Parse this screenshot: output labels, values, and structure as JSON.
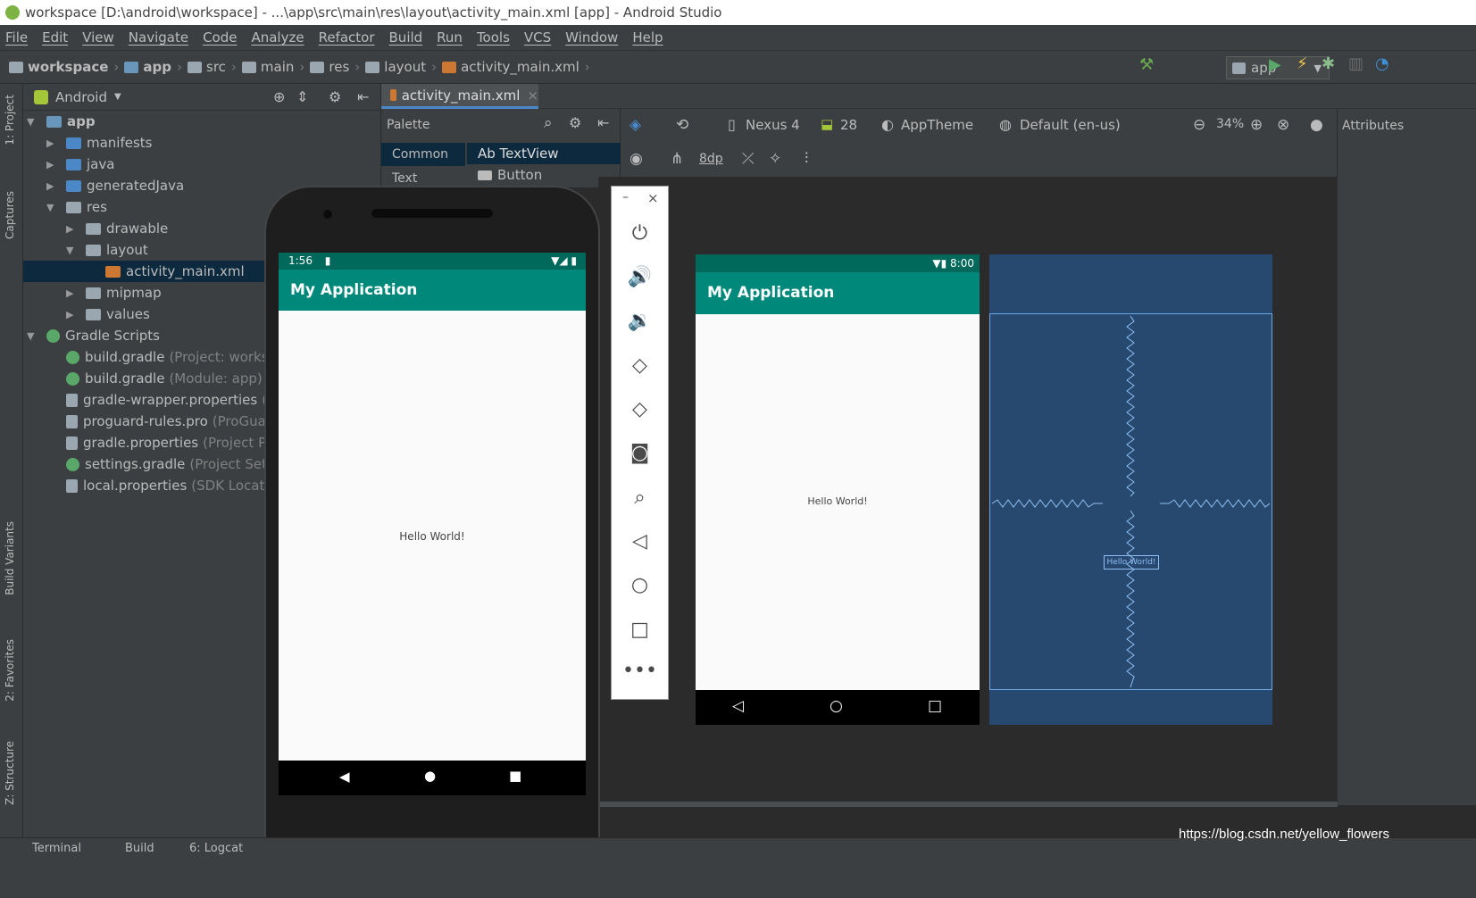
{
  "window": {
    "title": "workspace [D:\\android\\workspace] - ...\\app\\src\\main\\res\\layout\\activity_main.xml [app] - Android Studio"
  },
  "menu": [
    "File",
    "Edit",
    "View",
    "Navigate",
    "Code",
    "Analyze",
    "Refactor",
    "Build",
    "Run",
    "Tools",
    "VCS",
    "Window",
    "Help"
  ],
  "breadcrumbs": [
    "workspace",
    "app",
    "src",
    "main",
    "res",
    "layout",
    "activity_main.xml"
  ],
  "run_config": "app",
  "left_tool_tabs": [
    "1: Project",
    "Captures",
    "Build Variants",
    "2: Favorites",
    "Z: Structure"
  ],
  "project": {
    "view_mode": "Android",
    "tree": [
      {
        "label": "app",
        "hint": ""
      },
      {
        "label": "manifests",
        "hint": ""
      },
      {
        "label": "java",
        "hint": ""
      },
      {
        "label": "generatedJava",
        "hint": ""
      },
      {
        "label": "res",
        "hint": ""
      },
      {
        "label": "drawable",
        "hint": ""
      },
      {
        "label": "layout",
        "hint": ""
      },
      {
        "label": "activity_main.xml",
        "hint": ""
      },
      {
        "label": "mipmap",
        "hint": ""
      },
      {
        "label": "values",
        "hint": ""
      },
      {
        "label": "Gradle Scripts",
        "hint": ""
      },
      {
        "label": "build.gradle",
        "hint": "(Project: workspa"
      },
      {
        "label": "build.gradle",
        "hint": "(Module: app)"
      },
      {
        "label": "gradle-wrapper.properties",
        "hint": "(G"
      },
      {
        "label": "proguard-rules.pro",
        "hint": "(ProGuard"
      },
      {
        "label": "gradle.properties",
        "hint": "(Project Pro"
      },
      {
        "label": "settings.gradle",
        "hint": "(Project Settin"
      },
      {
        "label": "local.properties",
        "hint": "(SDK Locatio"
      }
    ]
  },
  "editor": {
    "tab": "activity_main.xml",
    "palette": {
      "title": "Palette",
      "categories": [
        "Common",
        "Text"
      ],
      "items": [
        "Ab TextView",
        "Button"
      ]
    },
    "toolbar": {
      "device": "Nexus 4",
      "api": "28",
      "theme": "AppTheme",
      "locale": "Default (en-us)",
      "zoom": "34%",
      "margin": "8dp",
      "attributes": "Attributes"
    },
    "design_preview": {
      "time": "8:00",
      "app_title": "My Application",
      "text": "Hello World!"
    },
    "blueprint": {
      "text": "Hello World!"
    }
  },
  "emulator": {
    "time": "1:56",
    "app_title": "My Application",
    "text": "Hello World!"
  },
  "bottom_tabs": [
    "Terminal",
    "Build",
    "6: Logcat"
  ],
  "watermark": "https://blog.csdn.net/yellow_flowers"
}
